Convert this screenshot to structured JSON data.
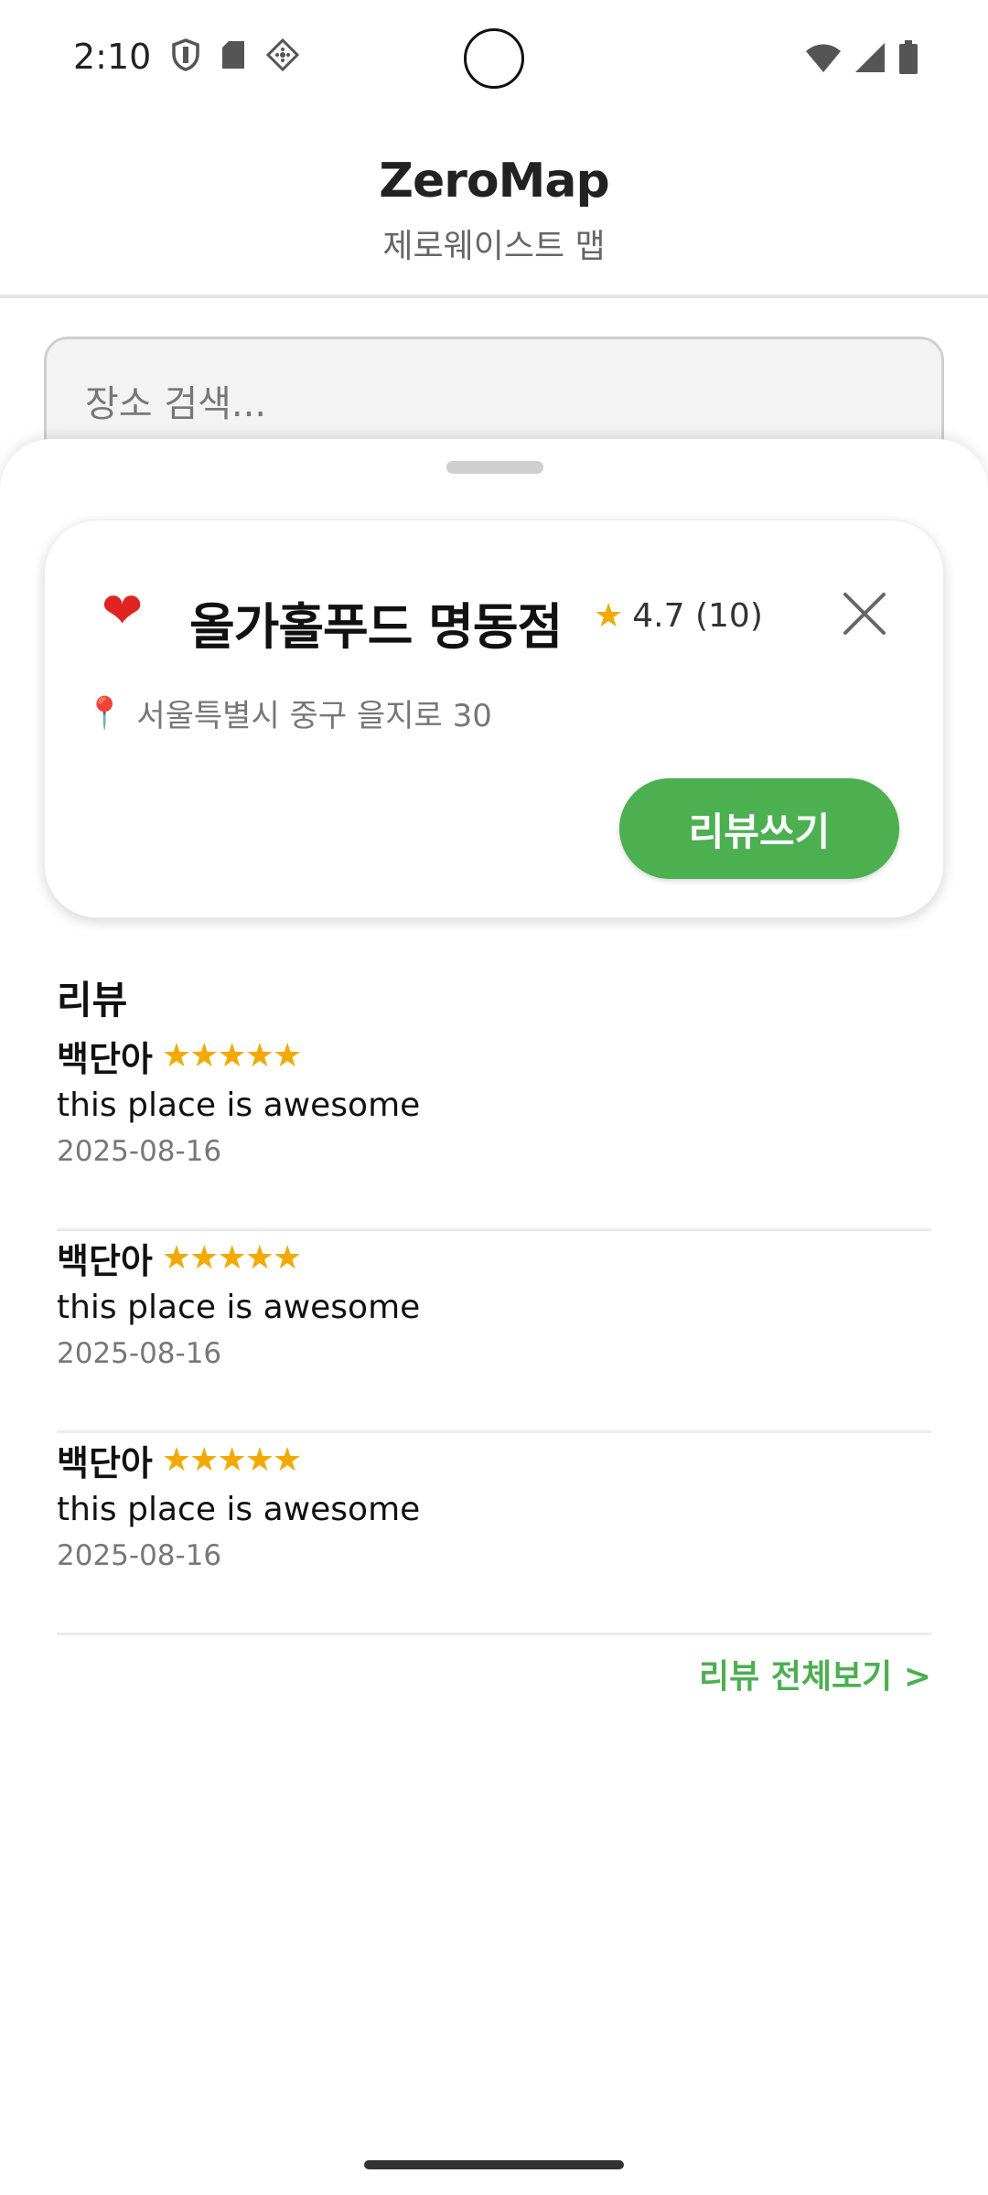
{
  "status_bar": {
    "time": "2:10",
    "left_icons": [
      "shield-icon",
      "sd-card-icon",
      "cast-icon"
    ],
    "right_icons": [
      "wifi-icon",
      "signal-icon",
      "battery-icon"
    ]
  },
  "app": {
    "title": "ZeroMap",
    "subtitle": "제로웨이스트 맵"
  },
  "search": {
    "placeholder": "장소 검색..."
  },
  "place": {
    "favorite_icon": "heart-icon",
    "name": "올가홀푸드 명동점",
    "rating": "4.7 (10)",
    "address": "서울특별시 중구 을지로 30",
    "write_review_label": "리뷰쓰기"
  },
  "reviews": {
    "title": "리뷰",
    "items": [
      {
        "author": "백단아",
        "stars": "★★★★★",
        "rating": 5,
        "text": "this place is awesome",
        "date": "2025-08-16"
      },
      {
        "author": "백단아",
        "stars": "★★★★★",
        "rating": 5,
        "text": "this place is awesome",
        "date": "2025-08-16"
      },
      {
        "author": "백단아",
        "stars": "★★★★★",
        "rating": 5,
        "text": "this place is awesome",
        "date": "2025-08-16"
      }
    ],
    "see_all_label": "리뷰 전체보기 >"
  },
  "colors": {
    "accent_green": "#4caf50",
    "star": "#f2a900",
    "heart": "#e02424"
  }
}
